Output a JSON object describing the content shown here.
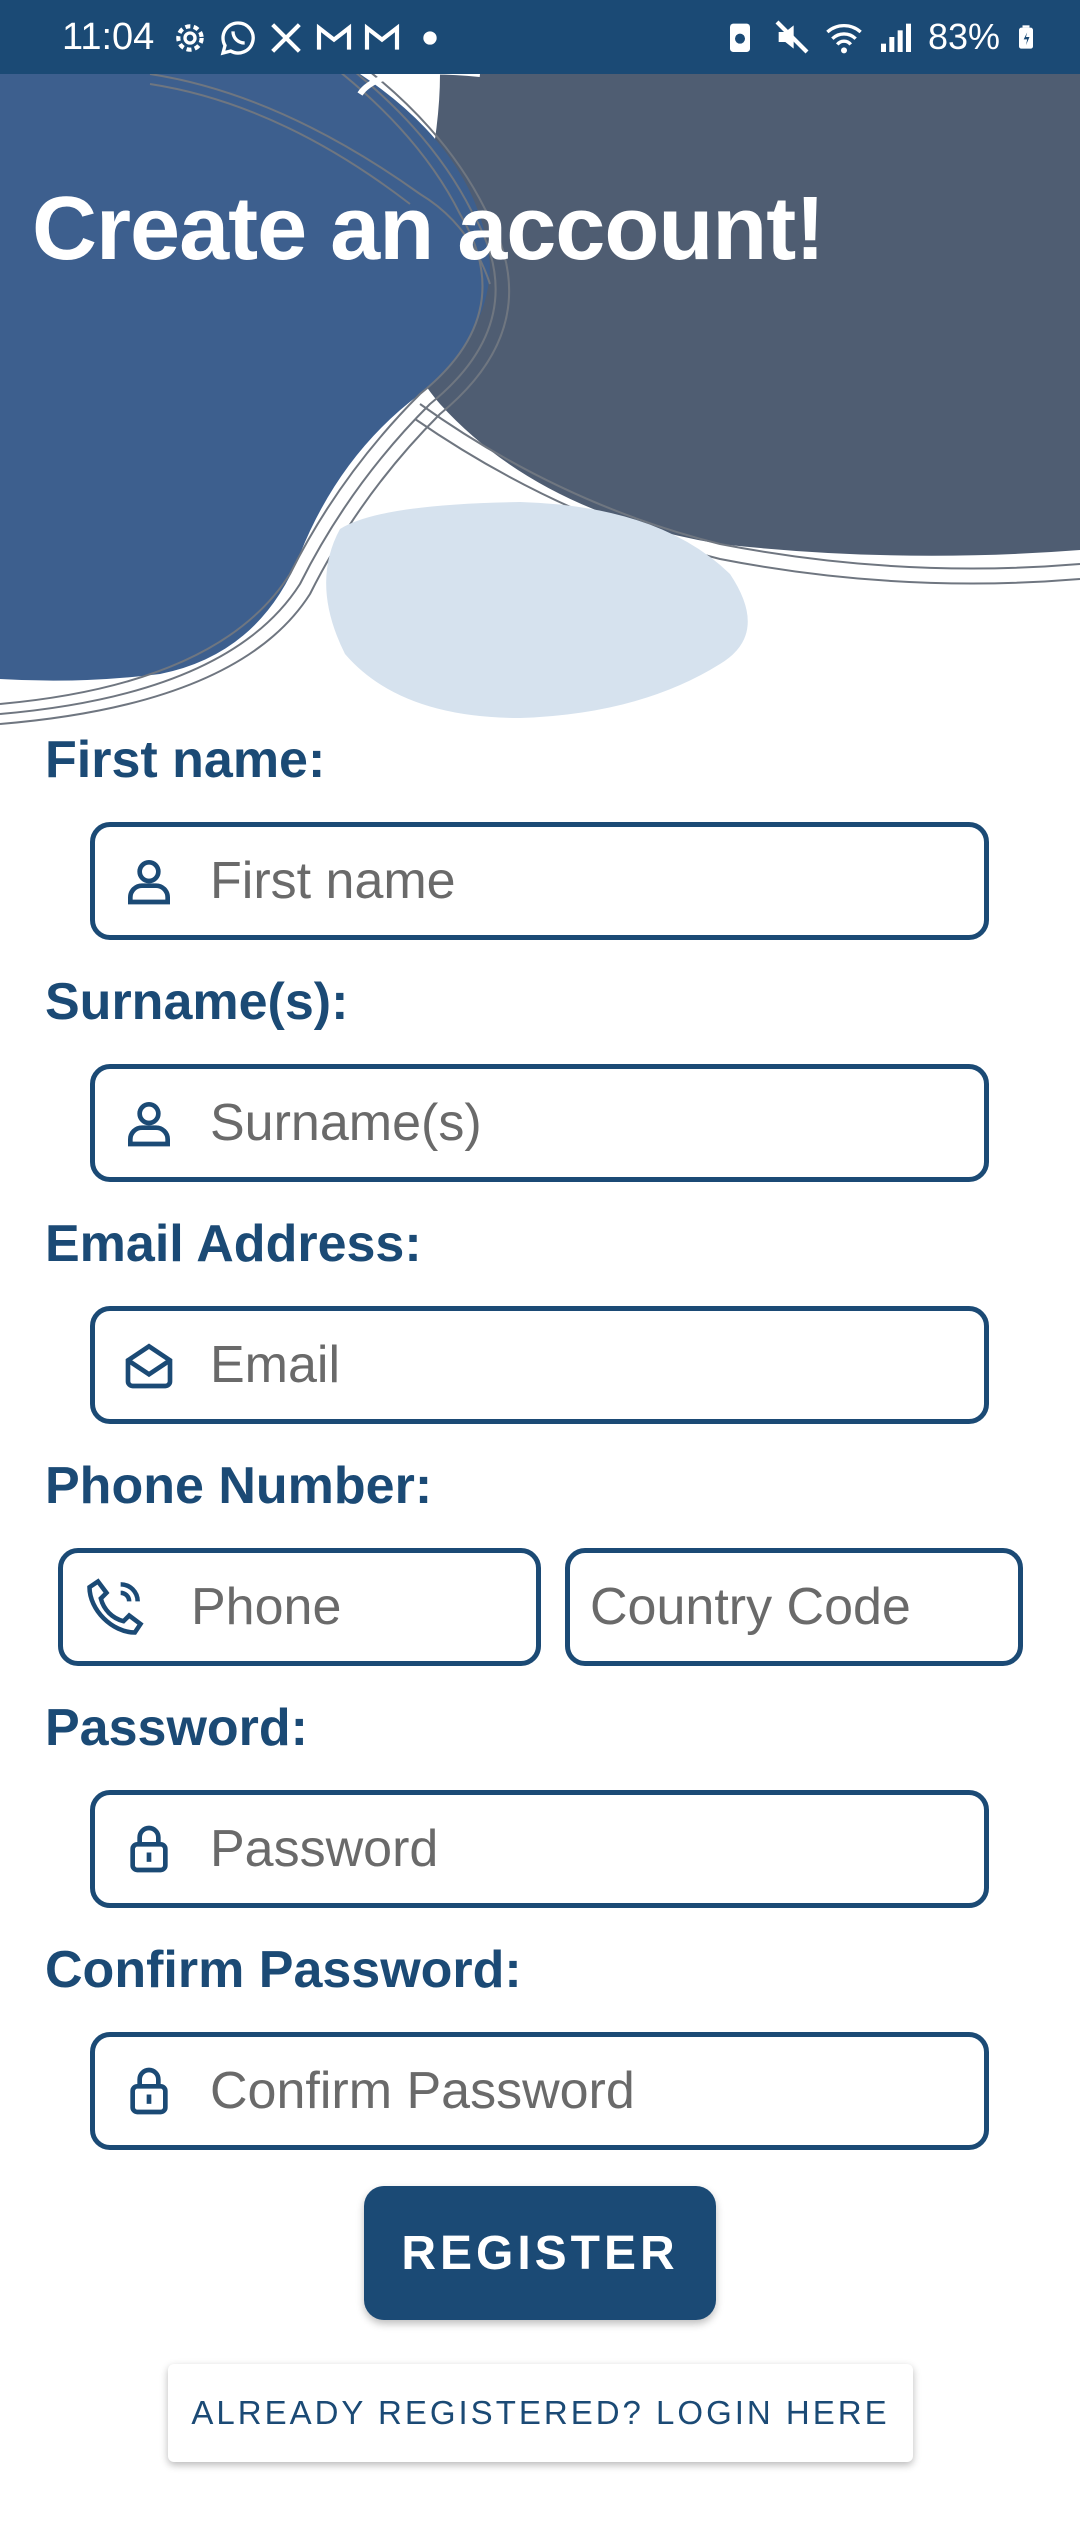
{
  "status_bar": {
    "time": "11:04",
    "battery": "83%",
    "left_icons": [
      "gear-icon",
      "whatsapp-icon",
      "x-icon",
      "gmail-icon",
      "gmail-icon",
      "dot-icon"
    ],
    "right_icons": [
      "battery-saver-icon",
      "mute-icon",
      "wifi-icon",
      "signal-icon",
      "battery-icon"
    ]
  },
  "header": {
    "title": "Create an account!"
  },
  "form": {
    "first_name": {
      "label": "First name:",
      "placeholder": "First name",
      "value": "",
      "icon": "person-icon"
    },
    "surname": {
      "label": "Surname(s):",
      "placeholder": "Surname(s)",
      "value": "",
      "icon": "person-icon"
    },
    "email": {
      "label": "Email Address:",
      "placeholder": "Email",
      "value": "",
      "icon": "mail-icon"
    },
    "phone": {
      "label": "Phone Number:",
      "placeholder": "Phone",
      "value": "",
      "icon": "phone-icon",
      "country_code_placeholder": "Country Code",
      "country_code_value": ""
    },
    "password": {
      "label": "Password:",
      "placeholder": "Password",
      "value": "",
      "icon": "lock-icon"
    },
    "confirm_password": {
      "label": "Confirm Password:",
      "placeholder": "Confirm Password",
      "value": "",
      "icon": "lock-icon"
    }
  },
  "actions": {
    "register_label": "REGISTER",
    "login_label": "ALREADY REGISTERED? LOGIN HERE"
  },
  "colors": {
    "primary": "#1b4a75",
    "header_blue": "#3d5f8e",
    "header_slate": "#4f5d72",
    "blob_light": "#d6e2ee"
  }
}
